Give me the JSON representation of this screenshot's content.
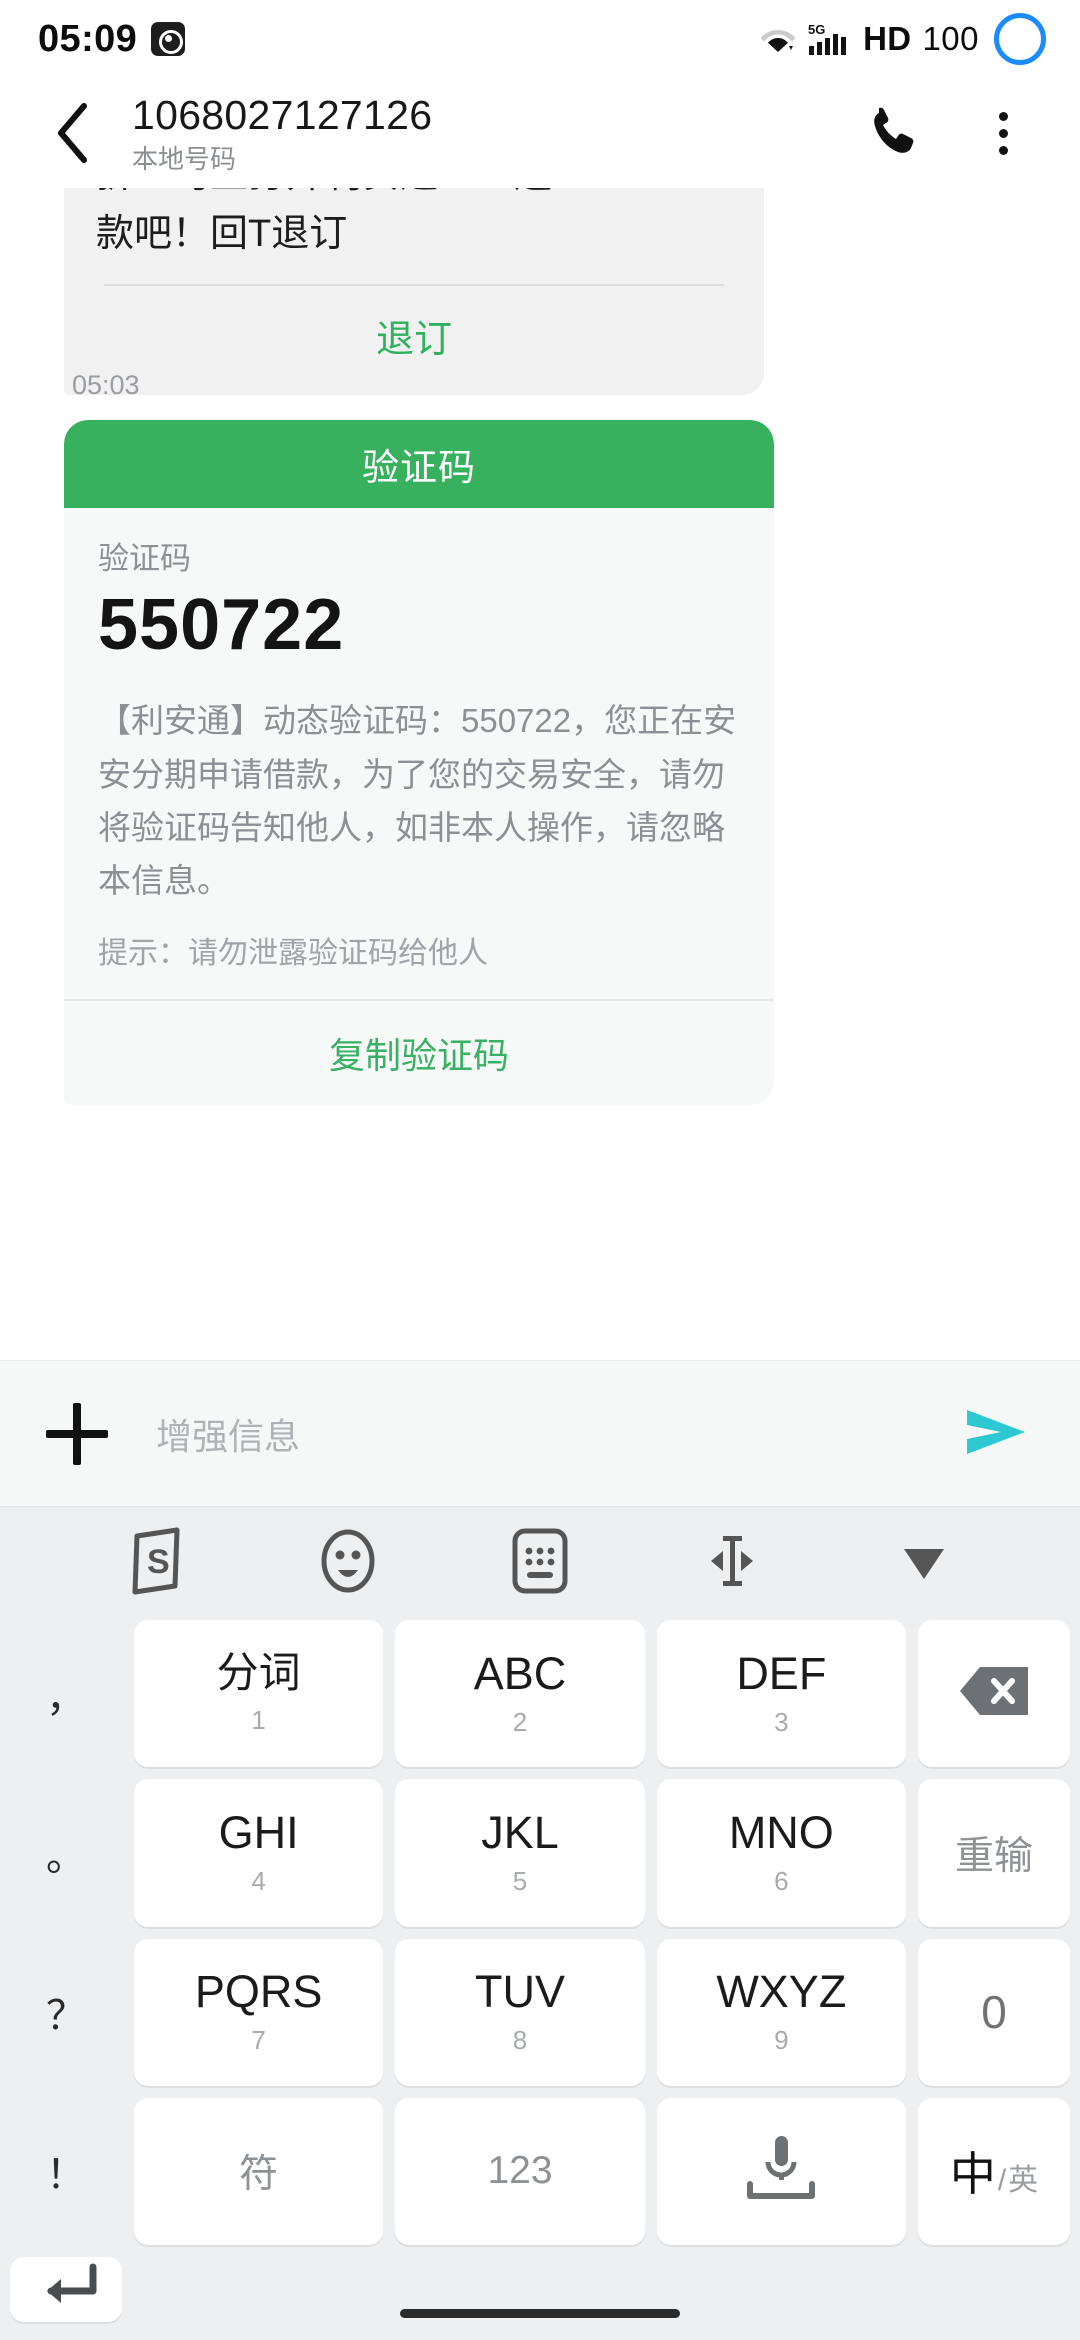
{
  "status_bar": {
    "time": "05:09",
    "app_icon": "weibo-icon",
    "wifi": "wifi-icon",
    "network": "5G",
    "signal": "signal-bars-icon",
    "hd": "HD",
    "battery_percent": "100",
    "battery_ring_color": "#1a8cff"
  },
  "header": {
    "back": "back-chevron",
    "number": "1068027127126",
    "subtitle": "本地号码",
    "call": "phone-icon",
    "more": "overflow-menu-icon"
  },
  "thread": {
    "messages": [
      {
        "type": "clipped_bubble",
        "line1": "折：马上打开利安通APP还",
        "line2": "款吧！回T退订",
        "action": "退订",
        "action_color": "#2fb25f"
      },
      {
        "type": "timestamp",
        "value": "05:03"
      },
      {
        "type": "verification_card",
        "header": "验证码",
        "header_bg": "#38b15f",
        "label": "验证码",
        "code": "550722",
        "body": "【利安通】动态验证码：550722，您正在安安分期申请借款，为了您的交易安全，请勿将验证码告知他人，如非本人操作，请忽略本信息。",
        "hint": "提示：请勿泄露验证码给他人",
        "copy_action": "复制验证码",
        "copy_color": "#39b163"
      }
    ]
  },
  "input_bar": {
    "add": "plus-icon",
    "placeholder": "增强信息",
    "send": "send-icon",
    "send_color": "#2ec8d3"
  },
  "keyboard": {
    "toolbar": [
      {
        "name": "sogou-logo-icon",
        "label": "S"
      },
      {
        "name": "emoji-icon",
        "label": ""
      },
      {
        "name": "keyboard-switch-icon",
        "label": ""
      },
      {
        "name": "cursor-move-icon",
        "label": ""
      },
      {
        "name": "hide-keyboard-icon",
        "label": ""
      }
    ],
    "rows": [
      [
        {
          "name": "key-comma",
          "kind": "punct",
          "main": "，"
        },
        {
          "name": "key-fenci",
          "kind": "cjk",
          "main": "分词",
          "sub": "1"
        },
        {
          "name": "key-abc",
          "kind": "letters",
          "main": "ABC",
          "sub": "2"
        },
        {
          "name": "key-def",
          "kind": "letters",
          "main": "DEF",
          "sub": "3"
        },
        {
          "name": "key-backspace",
          "kind": "backspace",
          "main": ""
        }
      ],
      [
        {
          "name": "key-period",
          "kind": "punct",
          "main": "。"
        },
        {
          "name": "key-ghi",
          "kind": "letters",
          "main": "GHI",
          "sub": "4"
        },
        {
          "name": "key-jkl",
          "kind": "letters",
          "main": "JKL",
          "sub": "5"
        },
        {
          "name": "key-mno",
          "kind": "letters",
          "main": "MNO",
          "sub": "6"
        },
        {
          "name": "key-redo",
          "kind": "fn",
          "main": "重输"
        }
      ],
      [
        {
          "name": "key-question",
          "kind": "punct",
          "main": "？"
        },
        {
          "name": "key-pqrs",
          "kind": "letters",
          "main": "PQRS",
          "sub": "7"
        },
        {
          "name": "key-tuv",
          "kind": "letters",
          "main": "TUV",
          "sub": "8"
        },
        {
          "name": "key-wxyz",
          "kind": "letters",
          "main": "WXYZ",
          "sub": "9"
        },
        {
          "name": "key-zero",
          "kind": "zero",
          "main": "0"
        }
      ],
      [
        {
          "name": "key-exclaim",
          "kind": "punct",
          "main": "！"
        },
        {
          "name": "key-symbols",
          "kind": "fn-grey",
          "main": "符"
        },
        {
          "name": "key-numbers",
          "kind": "fn-grey",
          "main": "123"
        },
        {
          "name": "key-space-voice",
          "kind": "space",
          "main": ""
        },
        {
          "name": "key-lang-toggle",
          "kind": "lang",
          "main": "中",
          "slash": "/",
          "sub": "英"
        },
        {
          "name": "key-enter",
          "kind": "enter",
          "main": ""
        }
      ]
    ]
  }
}
